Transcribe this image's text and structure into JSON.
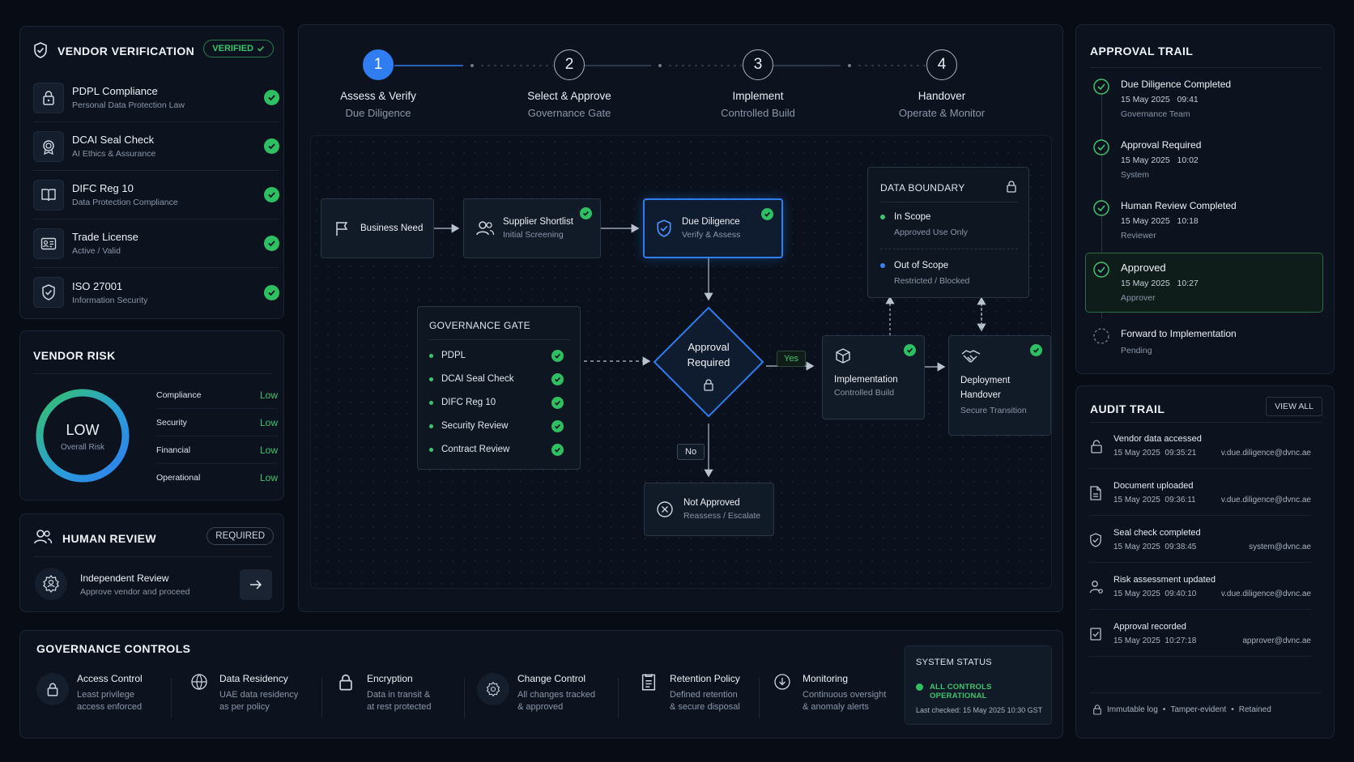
{
  "vendor_verification": {
    "title": "VENDOR VERIFICATION",
    "badge": "VERIFIED",
    "items": [
      {
        "title": "PDPL Compliance",
        "subtitle": "Personal Data Protection Law"
      },
      {
        "title": "DCAI Seal Check",
        "subtitle": "AI Ethics & Assurance"
      },
      {
        "title": "DIFC Reg 10",
        "subtitle": "Data Protection Compliance"
      },
      {
        "title": "Trade License",
        "subtitle": "Active / Valid"
      },
      {
        "title": "ISO 27001",
        "subtitle": "Information Security"
      }
    ]
  },
  "vendor_risk": {
    "title": "VENDOR RISK",
    "overall_value": "LOW",
    "overall_label": "Overall Risk",
    "rows": [
      {
        "label": "Compliance",
        "value": "Low"
      },
      {
        "label": "Security",
        "value": "Low"
      },
      {
        "label": "Financial",
        "value": "Low"
      },
      {
        "label": "Operational",
        "value": "Low"
      }
    ]
  },
  "human_review": {
    "title": "HUMAN REVIEW",
    "badge": "REQUIRED",
    "item_title": "Independent Review",
    "item_subtitle": "Approve vendor and proceed"
  },
  "steps": [
    {
      "num": "1",
      "title": "Assess & Verify",
      "subtitle": "Due Diligence"
    },
    {
      "num": "2",
      "title": "Select & Approve",
      "subtitle": "Governance Gate"
    },
    {
      "num": "3",
      "title": "Implement",
      "subtitle": "Controlled Build"
    },
    {
      "num": "4",
      "title": "Handover",
      "subtitle": "Operate & Monitor"
    }
  ],
  "flow": {
    "business_need": "Business Need",
    "supplier_title": "Supplier Shortlist",
    "supplier_sub": "Initial Screening",
    "dd_title": "Due Diligence",
    "dd_sub": "Verify & Assess",
    "approval_line1": "Approval",
    "approval_line2": "Required",
    "yes": "Yes",
    "no": "No",
    "impl_title": "Implementation",
    "impl_sub": "Controlled Build",
    "deploy_title1": "Deployment",
    "deploy_title2": "Handover",
    "deploy_sub": "Secure Transition",
    "not_approved_title": "Not Approved",
    "not_approved_sub": "Reassess / Escalate"
  },
  "governance_gate": {
    "title": "GOVERNANCE GATE",
    "items": [
      "PDPL",
      "DCAI Seal Check",
      "DIFC Reg 10",
      "Security Review",
      "Contract Review"
    ]
  },
  "data_boundary": {
    "title": "DATA BOUNDARY",
    "in_scope_title": "In Scope",
    "in_scope_sub": "Approved Use Only",
    "out_scope_title": "Out of Scope",
    "out_scope_sub": "Restricted / Blocked",
    "in_color": "#3ec46d",
    "out_color": "#3b82f6"
  },
  "approval_trail": {
    "title": "APPROVAL TRAIL",
    "items": [
      {
        "title": "Due Diligence Completed",
        "date": "15 May 2025",
        "time": "09:41",
        "actor": "Governance Team"
      },
      {
        "title": "Approval Required",
        "date": "15 May 2025",
        "time": "10:02",
        "actor": "System"
      },
      {
        "title": "Human Review Completed",
        "date": "15 May 2025",
        "time": "10:18",
        "actor": "Reviewer"
      },
      {
        "title": "Approved",
        "date": "15 May 2025",
        "time": "10:27",
        "actor": "Approver"
      }
    ],
    "pending_title": "Forward to Implementation",
    "pending_status": "Pending"
  },
  "audit_trail": {
    "title": "AUDIT TRAIL",
    "view_all": "VIEW ALL",
    "items": [
      {
        "action": "Vendor data accessed",
        "date": "15 May 2025",
        "time": "09:35:21",
        "user": "v.due.diligence@dvnc.ae"
      },
      {
        "action": "Document uploaded",
        "date": "15 May 2025",
        "time": "09:36:11",
        "user": "v.due.diligence@dvnc.ae"
      },
      {
        "action": "Seal check completed",
        "date": "15 May 2025",
        "time": "09:38:45",
        "user": "system@dvnc.ae"
      },
      {
        "action": "Risk assessment updated",
        "date": "15 May 2025",
        "time": "09:40:10",
        "user": "v.due.diligence@dvnc.ae"
      },
      {
        "action": "Approval recorded",
        "date": "15 May 2025",
        "time": "10:27:18",
        "user": "approver@dvnc.ae"
      }
    ],
    "footer": [
      "Immutable log",
      "Tamper-evident",
      "Retained"
    ]
  },
  "governance_controls": {
    "title": "GOVERNANCE CONTROLS",
    "items": [
      {
        "title": "Access Control",
        "line1": "Least privilege",
        "line2": "access enforced",
        "icon": "lock-icon"
      },
      {
        "title": "Data Residency",
        "line1": "UAE data residency",
        "line2": "as per policy",
        "icon": "globe-icon"
      },
      {
        "title": "Encryption",
        "line1": "Data in transit &",
        "line2": "at rest protected",
        "icon": "padlock-icon"
      },
      {
        "title": "Change Control",
        "line1": "All changes tracked",
        "line2": "& approved",
        "icon": "gear-icon"
      },
      {
        "title": "Retention Policy",
        "line1": "Defined retention",
        "line2": "& secure disposal",
        "icon": "document-icon"
      },
      {
        "title": "Monitoring",
        "line1": "Continuous oversight",
        "line2": "& anomaly alerts",
        "icon": "monitor-icon"
      }
    ]
  },
  "system_status": {
    "title": "SYSTEM STATUS",
    "status": "ALL CONTROLS OPERATIONAL",
    "last_checked": "Last checked: 15 May 2025 10:30 GST"
  },
  "colors": {
    "accent": "#2f7df0",
    "success": "#2fbf63",
    "background": "#070c15",
    "panel": "#0c131f"
  }
}
